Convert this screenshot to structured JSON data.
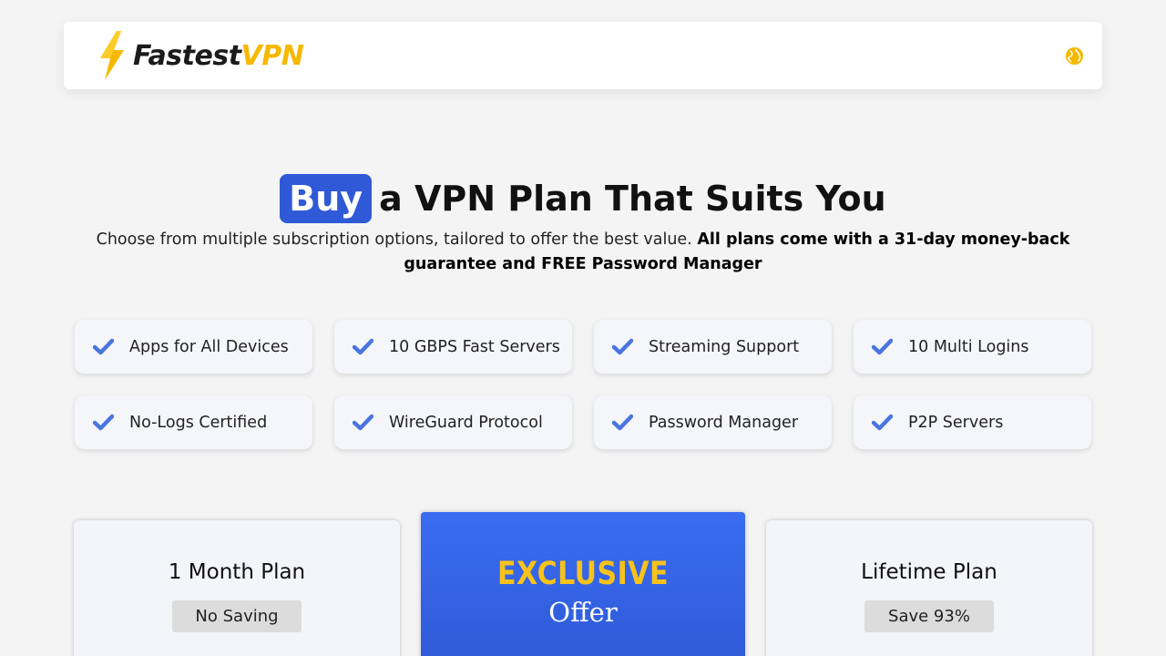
{
  "header": {
    "logo": {
      "word_dark": "Fastest",
      "word_accent": "VPN",
      "icon": "lightning-bolt-icon"
    },
    "language_icon": "globe-icon"
  },
  "hero": {
    "title_highlight": "Buy",
    "title_rest": "a VPN Plan That Suits You",
    "subtitle_regular": "Choose from multiple subscription options, tailored to offer the best value.",
    "subtitle_bold": "All plans come with a 31-day money-back guarantee and FREE Password Manager"
  },
  "features": [
    {
      "label": "Apps for All Devices",
      "icon": "check-icon"
    },
    {
      "label": "10 GBPS Fast Servers",
      "icon": "check-icon"
    },
    {
      "label": "Streaming Support",
      "icon": "check-icon"
    },
    {
      "label": "10 Multi Logins",
      "icon": "check-icon"
    },
    {
      "label": "No-Logs Certified",
      "icon": "check-icon"
    },
    {
      "label": "WireGuard Protocol",
      "icon": "check-icon"
    },
    {
      "label": "Password Manager",
      "icon": "check-icon"
    },
    {
      "label": "P2P Servers",
      "icon": "check-icon"
    }
  ],
  "plans": {
    "left": {
      "name": "1 Month Plan",
      "badge": "No Saving"
    },
    "featured": {
      "headline": "EXCLUSIVE",
      "subline": "Offer"
    },
    "right": {
      "name": "Lifetime Plan",
      "badge": "Save 93%"
    }
  },
  "colors": {
    "brand_blue": "#2f59d6",
    "brand_yellow": "#f6b800",
    "check_blue": "#4a74e0",
    "background": "#f4f4f5"
  }
}
